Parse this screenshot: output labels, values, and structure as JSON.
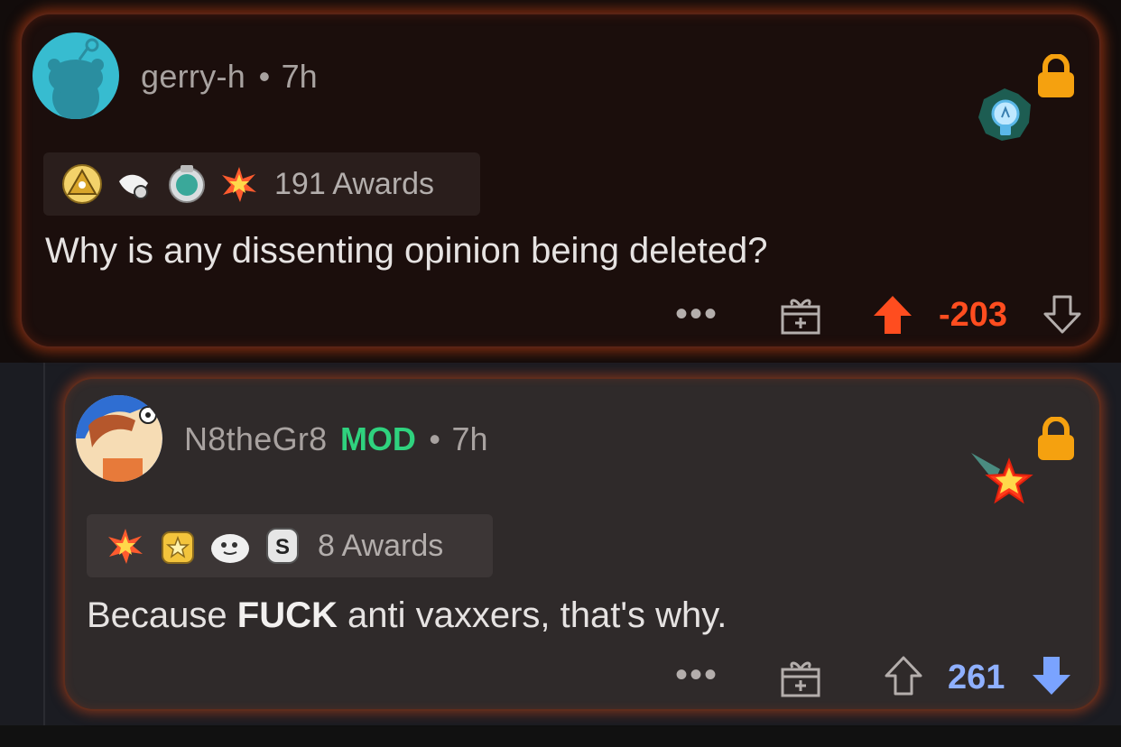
{
  "comments": [
    {
      "username": "gerry-h",
      "separator": "•",
      "time": "7h",
      "awards_label": "191 Awards",
      "award_icons": [
        "triangle-award-icon",
        "pointing-hand-award-icon",
        "silver-medal-award-icon",
        "starburst-award-icon"
      ],
      "flair_icon": "lightbulb-icon",
      "body": "Why is any dissenting opinion being deleted?",
      "more_label": "•••",
      "score": "-203",
      "vote_state": "upvoted",
      "score_color": "#ff4d1f"
    },
    {
      "username": "N8theGr8",
      "mod_badge": "MOD",
      "separator": "•",
      "time": "7h",
      "awards_label": "8 Awards",
      "award_icons": [
        "starburst-award-icon",
        "star-badge-award-icon",
        "ghost-award-icon",
        "s-coin-award-icon"
      ],
      "flair_icon": "shooting-star-icon",
      "body_prefix": "Because ",
      "body_bold": "FUCK",
      "body_suffix": " anti vaxxers, that's why.",
      "more_label": "•••",
      "score": "261",
      "vote_state": "downvoted",
      "score_color": "#8fb0ff"
    }
  ],
  "colors": {
    "lock": "#f5a10f",
    "upvote": "#ff4d1f",
    "downvote": "#7aa3ff",
    "mod": "#2fd27e"
  }
}
